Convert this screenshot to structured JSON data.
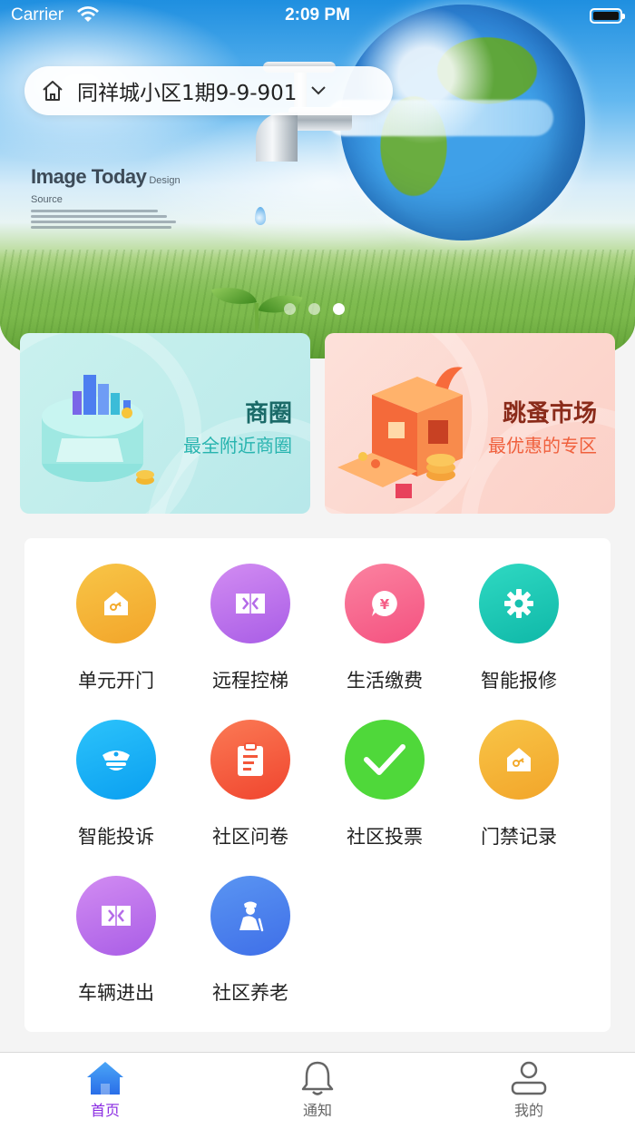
{
  "status_bar": {
    "carrier": "Carrier",
    "time": "2:09 PM"
  },
  "header": {
    "address": "同祥城小区1期9-9-901"
  },
  "banner": {
    "brand_title": "Image Today",
    "brand_subtitle": "Design Source",
    "slide_count": 3,
    "active_slide": 3
  },
  "cards": [
    {
      "title": "商圈",
      "subtitle": "最全附近商圈"
    },
    {
      "title": "跳蚤市场",
      "subtitle": "最优惠的专区"
    }
  ],
  "services": [
    {
      "label": "单元开门",
      "icon": "home-key-icon"
    },
    {
      "label": "远程控梯",
      "icon": "elevator-icon"
    },
    {
      "label": "生活缴费",
      "icon": "yen-bubble-icon"
    },
    {
      "label": "智能报修",
      "icon": "gear-icon"
    },
    {
      "label": "智能投诉",
      "icon": "police-cap-icon"
    },
    {
      "label": "社区问卷",
      "icon": "clipboard-icon"
    },
    {
      "label": "社区投票",
      "icon": "checkmark-icon"
    },
    {
      "label": "门禁记录",
      "icon": "home-key-icon"
    },
    {
      "label": "车辆进出",
      "icon": "gate-icon"
    },
    {
      "label": "社区养老",
      "icon": "elderly-icon"
    }
  ],
  "tabs": [
    {
      "label": "首页",
      "icon": "home-icon",
      "active": true
    },
    {
      "label": "通知",
      "icon": "bell-icon",
      "active": false
    },
    {
      "label": "我的",
      "icon": "person-icon",
      "active": false
    }
  ],
  "colors": {
    "accent": "#8a2be2",
    "yellow": "#f5b731",
    "purple": "#b872ea",
    "pink": "#f7678c",
    "teal": "#18c9b4",
    "blue": "#1ab0f5",
    "orange_red": "#f4603d",
    "green": "#4fd83a",
    "royal_blue": "#4a7ff0"
  }
}
